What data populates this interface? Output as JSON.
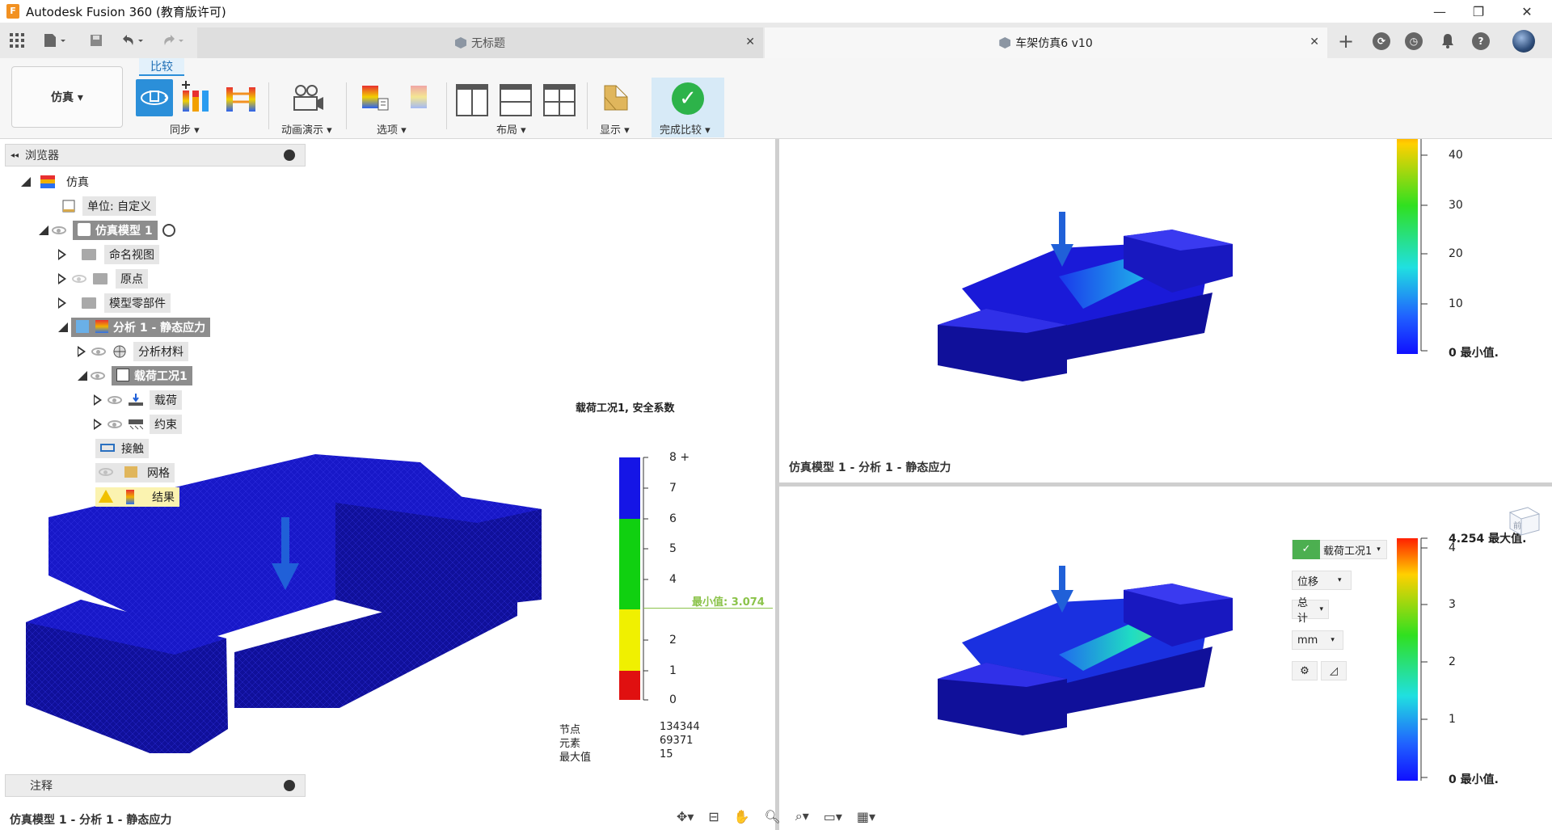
{
  "window": {
    "title": "Autodesk Fusion 360 (教育版许可)",
    "logo_letter": "F",
    "minimize": "—",
    "restore": "❐",
    "close": "✕"
  },
  "tabs": [
    {
      "label": "无标题",
      "close": "✕"
    },
    {
      "label": "车架仿真6 v10",
      "close": "✕"
    }
  ],
  "toolbar_right": {
    "plus": "+",
    "help": "?"
  },
  "ribbon": {
    "workspace": "仿真 ▾",
    "context_tab": "比较",
    "groups": [
      {
        "label": "同步 ▾"
      },
      {
        "label": "动画演示 ▾"
      },
      {
        "label": "选项 ▾"
      },
      {
        "label": "布局 ▾"
      },
      {
        "label": "显示 ▾"
      },
      {
        "label": "完成比较 ▾"
      }
    ],
    "finish_check": "✓"
  },
  "browser": {
    "title": "浏览器",
    "arrows": "◂◂",
    "items": [
      {
        "label": "仿真"
      },
      {
        "label": "单位: 自定义"
      },
      {
        "label": "仿真模型 1"
      },
      {
        "label": "命名视图"
      },
      {
        "label": "原点"
      },
      {
        "label": "模型零部件"
      },
      {
        "label": "分析 1 - 静态应力"
      },
      {
        "label": "分析材料"
      },
      {
        "label": "载荷工况1"
      },
      {
        "label": "载荷"
      },
      {
        "label": "约束"
      },
      {
        "label": "接触"
      },
      {
        "label": "网格"
      },
      {
        "label": "结果"
      }
    ]
  },
  "notes": {
    "title": "注释"
  },
  "left_viewport": {
    "legend_title": "载荷工况1, 安全系数",
    "ticks": [
      "8 +",
      "7",
      "6",
      "5",
      "4",
      "2",
      "1",
      "0"
    ],
    "min_marker": "最小值: 3.074",
    "stats": {
      "nodes_label": "节点",
      "nodes_value": "134344",
      "elements_label": "元素",
      "elements_value": "69371",
      "max_label": "最大值",
      "max_value": "15"
    },
    "caption": "仿真模型 1 - 分析 1 - 静态应力",
    "colors": {
      "band_blue": "#1515e6",
      "band_green": "#10d010",
      "band_yellow": "#f0f000",
      "band_red": "#e01010",
      "min_line": "#8bc34a"
    }
  },
  "top_right_viewport": {
    "ticks": [
      "40",
      "30",
      "20",
      "10",
      "0 最小值."
    ],
    "caption": "仿真模型 1 - 分析 1 - 静态应力"
  },
  "bottom_right_viewport": {
    "ticks": [
      "4.254 最大值.",
      "4",
      "3",
      "2",
      "1",
      "0 最小值."
    ],
    "controls": {
      "loadcase": "载荷工况1",
      "result_type": "位移",
      "component": "总计",
      "unit": "mm"
    },
    "viewcube_label": "前"
  },
  "navbar": {
    "icons": [
      "orbit-icon",
      "look-at-icon",
      "pan-icon",
      "zoom-icon",
      "fit-icon",
      "display-icon",
      "grid-icon"
    ]
  }
}
